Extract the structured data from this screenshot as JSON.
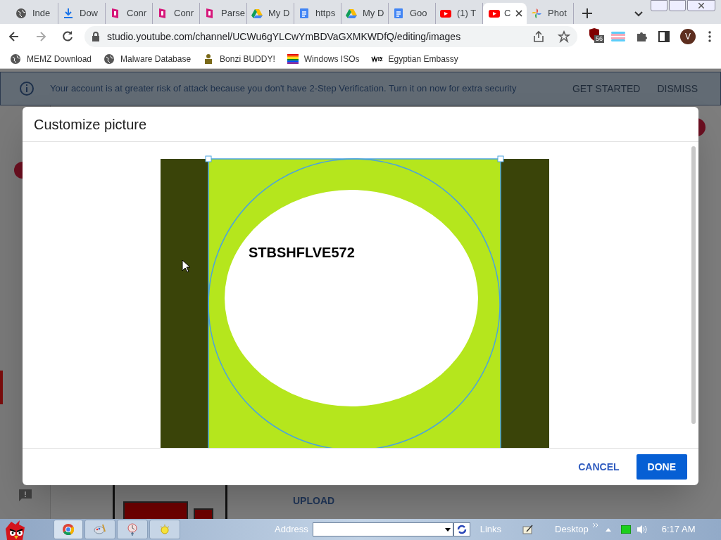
{
  "tabs": [
    {
      "title": "Inde",
      "kind": "globe",
      "selected": false
    },
    {
      "title": "Dow",
      "kind": "download",
      "selected": false
    },
    {
      "title": "Conr",
      "kind": "pink",
      "selected": false
    },
    {
      "title": "Conr",
      "kind": "pink",
      "selected": false
    },
    {
      "title": "Parse",
      "kind": "pink",
      "selected": false
    },
    {
      "title": "My D",
      "kind": "drive",
      "selected": false
    },
    {
      "title": "https",
      "kind": "doc",
      "selected": false
    },
    {
      "title": "My D",
      "kind": "drive",
      "selected": false
    },
    {
      "title": "Goo",
      "kind": "doc",
      "selected": false
    },
    {
      "title": "(1) T",
      "kind": "youtube",
      "selected": false
    },
    {
      "title": "C",
      "kind": "youtube",
      "selected": true
    },
    {
      "title": "Phot",
      "kind": "photos",
      "selected": false
    }
  ],
  "address": "studio.youtube.com/channel/UCWu6gYLCwYmBDVaGXMKWDfQ/editing/images",
  "extension_badge": "56",
  "profile_initial": "V",
  "bookmarks": [
    {
      "label": "MEMZ Download",
      "kind": "globe"
    },
    {
      "label": "Malware Database",
      "kind": "globe"
    },
    {
      "label": "Bonzi BUDDY!",
      "kind": "bonzi"
    },
    {
      "label": "Windows ISOs",
      "kind": "rainbow"
    },
    {
      "label": "Egyptian Embassy",
      "kind": "wix"
    }
  ],
  "banner": {
    "text": "Your account is at greater risk of attack because you don't have 2-Step Verification. Turn it on now for extra security",
    "actions": [
      "GET STARTED",
      "DISMISS"
    ]
  },
  "background_link": "UPLOAD",
  "dialog": {
    "title": "Customize picture",
    "picture_text": "STBSHFLVE572",
    "buttons": [
      {
        "label": "CANCEL",
        "kind": "text"
      },
      {
        "label": "DONE",
        "kind": "primary"
      }
    ]
  },
  "taskbar": {
    "address_label": "Address",
    "links_label": "Links",
    "desktop_label": "Desktop",
    "time": "6:17 AM"
  }
}
